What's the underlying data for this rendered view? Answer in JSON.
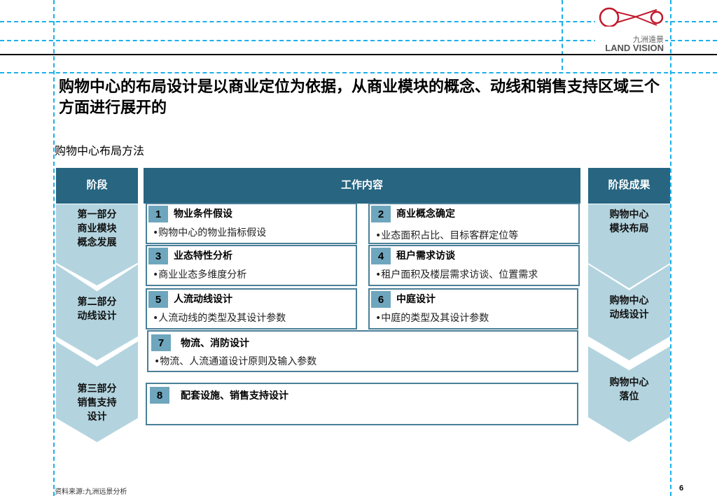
{
  "logo": {
    "cn": "九洲遠景",
    "en": "LAND VISION",
    "color": "#c0182a"
  },
  "title": "购物中心的布局设计是以商业定位为依据，从商业模块的概念、动线和销售支持区域三个方面进行展开的",
  "subtitle": "购物中心布局方法",
  "headers": {
    "stage": "阶段",
    "work": "工作内容",
    "result": "阶段成果"
  },
  "stages": [
    {
      "lines": [
        "第一部分",
        "商业模块",
        "概念发展"
      ]
    },
    {
      "lines": [
        "第二部分",
        "动线设计"
      ]
    },
    {
      "lines": [
        "第三部分",
        "销售支持",
        "设计"
      ]
    }
  ],
  "results": [
    {
      "lines": [
        "购物中心",
        "模块布局"
      ]
    },
    {
      "lines": [
        "购物中心",
        "动线设计"
      ]
    },
    {
      "lines": [
        "购物中心",
        "落位"
      ]
    }
  ],
  "tasks": [
    {
      "num": "1",
      "title": "物业条件假设",
      "desc": "•购物中心的物业指标假设"
    },
    {
      "num": "2",
      "title": "商业概念确定",
      "desc": "•业态面积占比、目标客群定位等"
    },
    {
      "num": "3",
      "title": "业态特性分析",
      "desc": "•商业业态多维度分析"
    },
    {
      "num": "4",
      "title": "租户需求访谈",
      "desc": "•租户面积及楼层需求访谈、位置需求"
    },
    {
      "num": "5",
      "title": "人流动线设计",
      "desc": "•人流动线的类型及其设计参数"
    },
    {
      "num": "6",
      "title": "中庭设计",
      "desc": "•中庭的类型及其设计参数"
    },
    {
      "num": "7",
      "title": "物流、消防设计",
      "desc": "•物流、人流通道设计原则及输入参数"
    },
    {
      "num": "8",
      "title": "配套设施、销售支持设计",
      "desc": ""
    }
  ],
  "footer": {
    "source": "资料来源:九洲远景分析",
    "page": "6"
  }
}
